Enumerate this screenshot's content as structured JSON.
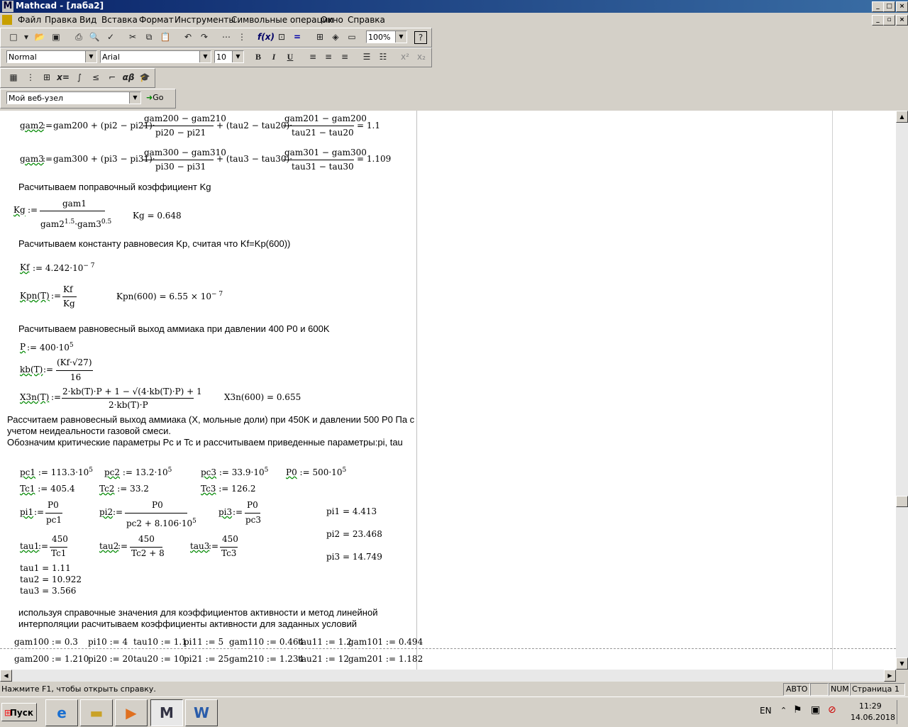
{
  "window": {
    "title": "Mathcad - [лаба2]",
    "app_icon": "M"
  },
  "menu": [
    "Файл",
    "Правка",
    "Вид",
    "Вставка",
    "Формат",
    "Инструменты",
    "Символьные операции",
    "Окно",
    "Справка"
  ],
  "toolbar": {
    "zoom": "100%",
    "style": "Normal",
    "font": "Arial",
    "size": "10",
    "web_url": "Мой веб-узел",
    "go_label": "Go",
    "bold": "B",
    "italic": "I",
    "underline": "U"
  },
  "doc": {
    "eq_gam2": {
      "lhs": "gam2",
      "a": "gam200 + (pi2 − pi21)·",
      "n1": "gam200 − gam210",
      "d1": "pi20 − pi21",
      "b": "+ (tau2 − tau20)·",
      "n2": "gam201 − gam200",
      "d2": "tau21 − tau20",
      "res": "= 1.1"
    },
    "eq_gam3": {
      "lhs": "gam3",
      "a": "gam300 + (pi3 − pi31)·",
      "n1": "gam300 − gam310",
      "d1": "pi30 − pi31",
      "b": "+ (tau3 − tau30)·",
      "n2": "gam301 − gam300",
      "d2": "tau31 − tau30",
      "res": "= 1.109"
    },
    "text1": "Расчитываем поправочный коэффициент Kg",
    "kg": {
      "lhs": "Kg",
      "num": "gam1",
      "den_a": "gam2",
      "exp_a": "1.5",
      "den_b": "·gam3",
      "exp_b": "0.5",
      "result": "Kg = 0.648"
    },
    "text2": "Расчитываем константу равновесия Kp, считая что Kf=Kp(600))",
    "kf": {
      "lhs": "Kf",
      "val": ":= 4.242·10",
      "exp": "− 7"
    },
    "kpn": {
      "lhs": "Kpn(T)",
      "num": "Kf",
      "den": "Kg",
      "result": "Kpn(600) = 6.55 × 10",
      "exp": "− 7"
    },
    "text3": "Расчитываем равновесный выход аммиака при давлении 400 P0 и 600K",
    "p": {
      "lhs": "P",
      "val": ":= 400·10",
      "exp": "5"
    },
    "kb": {
      "lhs": "kb(T)",
      "num": "(Kf·√27)",
      "den": "16"
    },
    "x3n": {
      "lhs": "X3n(T)",
      "num": "2·kb(T)·P + 1 − √(4·kb(T)·P) + 1",
      "den": "2·kb(T)·P",
      "result": "X3n(600) = 0.655"
    },
    "text4": "Рассчитаем равновесный выход аммиака (X, мольные доли) при 450K и давлении 500 P0 Па с",
    "text5": "учетом неидеальности газовой смеси.",
    "text6": "Обозначим критические параметры Pc и Tc и рассчитываем приведенные параметры:pi, tau",
    "pc1": {
      "lhs": "pc1",
      "val": ":= 113.3·10",
      "exp": "5"
    },
    "pc2": {
      "lhs": "pc2",
      "val": ":= 13.2·10",
      "exp": "5"
    },
    "pc3": {
      "lhs": "pc3",
      "val": ":= 33.9·10",
      "exp": "5"
    },
    "p0": {
      "lhs": "P0",
      "val": ":= 500·10",
      "exp": "5"
    },
    "tc1": {
      "lhs": "Tc1",
      "val": ":= 405.4"
    },
    "tc2": {
      "lhs": "Tc2",
      "val": ":= 33.2"
    },
    "tc3": {
      "lhs": "Tc3",
      "val": ":= 126.2"
    },
    "pi1": {
      "lhs": "pi1",
      "num": "P0",
      "den": "pc1"
    },
    "pi2": {
      "lhs": "pi2",
      "num": "P0",
      "den": "pc2 + 8.106·10",
      "exp": "5"
    },
    "pi3": {
      "lhs": "pi3",
      "num": "P0",
      "den": "pc3"
    },
    "pi_results": [
      "pi1 = 4.413",
      "pi2 = 23.468",
      "pi3 = 14.749"
    ],
    "tau1": {
      "lhs": "tau1",
      "num": "450",
      "den": "Tc1"
    },
    "tau2": {
      "lhs": "tau2",
      "num": "450",
      "den": "Tc2 + 8"
    },
    "tau3": {
      "lhs": "tau3",
      "num": "450",
      "den": "Tc3"
    },
    "tau_results": [
      "tau1 = 1.11",
      "tau2 = 10.922",
      "tau3 = 3.566"
    ],
    "text7": "используя справочные значения для коэффициентов активности и метод линейной",
    "text8": "интерполяции расчитываем коэффициенты активности для заданных условий",
    "row1": [
      "gam100 := 0.3",
      "pi10 := 4",
      "tau10 := 1.1",
      "pi11 := 5",
      "gam110 := 0.464",
      "tau11 := 1.2",
      "gam101 := 0.494"
    ],
    "row2": [
      "gam200 := 1.210",
      "pi20 := 20",
      "tau20 := 10",
      "pi21 := 25",
      "gam210 := 1.234",
      "tau21 := 12",
      "gam201 := 1.182"
    ]
  },
  "status": {
    "help": "Нажмите F1, чтобы открыть справку.",
    "mode": "АВТО",
    "num": "NUM",
    "page": "Страница 1"
  },
  "taskbar": {
    "start": "Пуск",
    "lang": "EN",
    "time": "11:29",
    "date": "14.06.2018"
  }
}
